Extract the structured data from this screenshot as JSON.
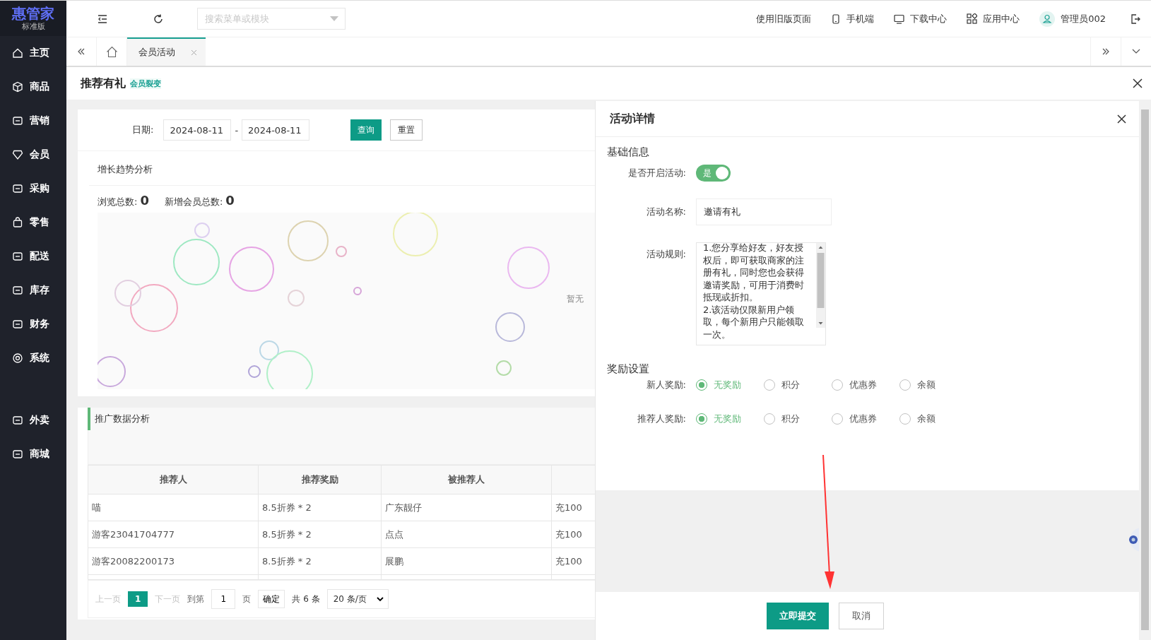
{
  "sidebar": {
    "logo": "惠管家",
    "edition": "标准版",
    "items": [
      {
        "label": "主页",
        "selected": false
      },
      {
        "label": "商品",
        "selected": false
      },
      {
        "label": "营销",
        "selected": false
      },
      {
        "label": "会员",
        "selected": false
      },
      {
        "label": "采购",
        "selected": false
      },
      {
        "label": "零售",
        "selected": false
      },
      {
        "label": "配送",
        "selected": false
      },
      {
        "label": "库存",
        "selected": false
      },
      {
        "label": "财务",
        "selected": false
      },
      {
        "label": "系统",
        "selected": false
      },
      {
        "label": "外卖",
        "selected": false
      },
      {
        "label": "商城",
        "selected": false
      }
    ]
  },
  "header": {
    "search": {
      "placeholder": "搜索菜单或模块"
    },
    "links": [
      {
        "kind": "text",
        "label": "使用旧版页面"
      },
      {
        "kind": "phone",
        "label": "手机端"
      },
      {
        "kind": "monitor",
        "label": "下载中心"
      },
      {
        "kind": "apps",
        "label": "应用中心"
      },
      {
        "kind": "user",
        "label": "管理员002"
      }
    ]
  },
  "tabs": [
    {
      "label": "会员活动",
      "selected": true
    }
  ],
  "page": {
    "title": "推荐有礼",
    "tag": "会员裂变"
  },
  "filter": {
    "label": "日期:",
    "start": "2024-08-11",
    "separator": "-",
    "end": "2024-08-11",
    "buttons": [
      {
        "kind": "primary",
        "label": "查询"
      },
      {
        "kind": "plain",
        "label": "重置"
      }
    ]
  },
  "trend": {
    "title": "增长趋势分析",
    "stats": [
      {
        "label": "浏览总数:",
        "value": "0"
      },
      {
        "label": "新增会员总数:",
        "value": "0"
      }
    ],
    "empty": "暂无"
  },
  "promo": {
    "title": "推广数据分析",
    "columns": [
      "推荐人",
      "推荐奖励",
      "被推荐人"
    ],
    "rows": [
      [
        "喵",
        "8.5折券 * 2",
        "广东靓仔",
        "充100"
      ],
      [
        "游客23041704777",
        "8.5折券 * 2",
        "点点",
        "充100"
      ],
      [
        "游客20082200173",
        "8.5折券 * 2",
        "展鹏",
        "充100"
      ]
    ]
  },
  "pagination": {
    "prev": {
      "label": "上一页",
      "disabled": true
    },
    "pages": [
      {
        "label": "1",
        "selected": true
      }
    ],
    "next": {
      "label": "下一页",
      "disabled": true
    },
    "goto": "到第",
    "page_input": "1",
    "page_unit": "页",
    "confirm": "确定",
    "total": "共 6 条",
    "page_size": "20 条/页"
  },
  "drawer": {
    "title": "活动详情",
    "basic_title": "基础信息",
    "toggle": {
      "label": "是否开启活动:",
      "on": true,
      "text": "是"
    },
    "name": {
      "label": "活动名称:",
      "value": "邀请有礼"
    },
    "rules": {
      "label": "活动规则:",
      "value": "1.您分享给好友，好友授权后，即可获取商家的注册有礼，同时您也会获得邀请奖励，可用于消费时抵现或折扣。\n2.该活动仅限新用户领取，每个新用户只能领取一次。"
    },
    "reward_title": "奖励设置",
    "rewards": [
      {
        "label": "新人奖励:",
        "options": [
          {
            "label": "无奖励",
            "selected": true
          },
          {
            "label": "积分",
            "selected": false
          },
          {
            "label": "优惠券",
            "selected": false
          },
          {
            "label": "余额",
            "selected": false
          }
        ]
      },
      {
        "label": "推荐人奖励:",
        "options": [
          {
            "label": "无奖励",
            "selected": true
          },
          {
            "label": "积分",
            "selected": false
          },
          {
            "label": "优惠券",
            "selected": false
          },
          {
            "label": "余额",
            "selected": false
          }
        ]
      }
    ],
    "buttons": [
      {
        "kind": "primary",
        "label": "立即提交"
      },
      {
        "kind": "plain",
        "label": "取消"
      }
    ]
  }
}
